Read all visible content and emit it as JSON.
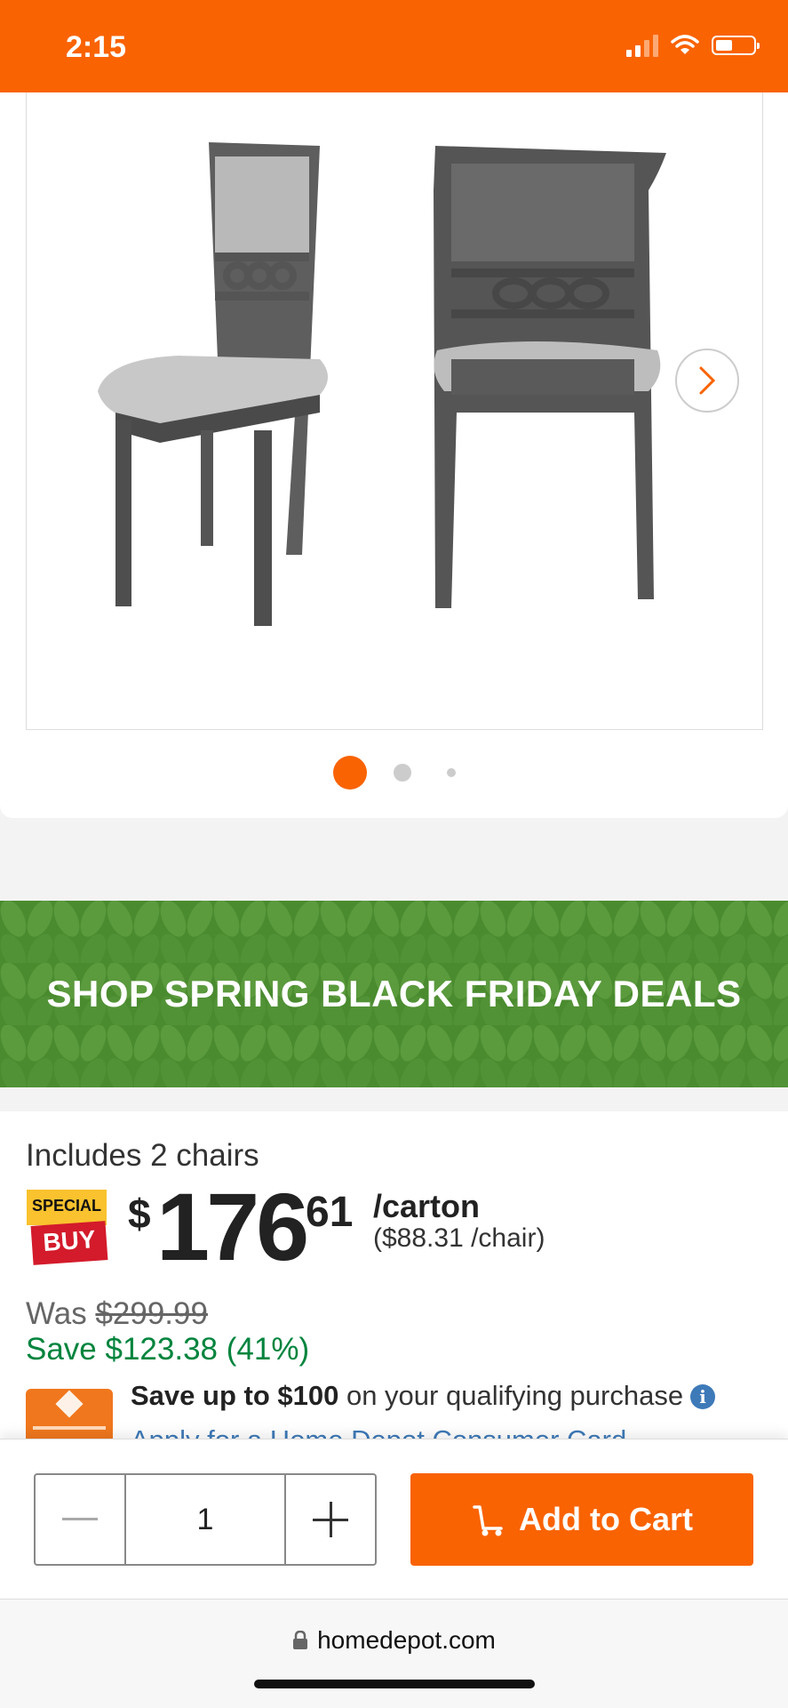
{
  "status_bar": {
    "time": "2:15",
    "background": "#f96302"
  },
  "gallery": {
    "image_alt": "Two gray wood dining chairs with linked-ring backs",
    "next_icon": "chevron-right-icon",
    "pages": 3,
    "active_page": 1
  },
  "promo": {
    "text": "SHOP SPRING BLACK FRIDAY DEALS",
    "color": "#4a8b2f"
  },
  "product": {
    "includes": "Includes 2 chairs",
    "badge_top": "SPECIAL",
    "badge_bottom": "BUY",
    "price_symbol": "$",
    "price_whole": "176",
    "price_cents": "61",
    "unit": "/carton",
    "per_unit": "($88.31 /chair)",
    "was_label": "Was",
    "was_price": "$299.99",
    "save_text": "Save $123.38 (41%)",
    "credit_bold": "Save up to $100",
    "credit_rest": " on your qualifying purchase",
    "apply_link": "Apply for a Home Depot Consumer Card"
  },
  "cart": {
    "quantity": "1",
    "add_label": "Add to Cart",
    "accent": "#f96302"
  },
  "browser": {
    "url": "homedepot.com"
  }
}
